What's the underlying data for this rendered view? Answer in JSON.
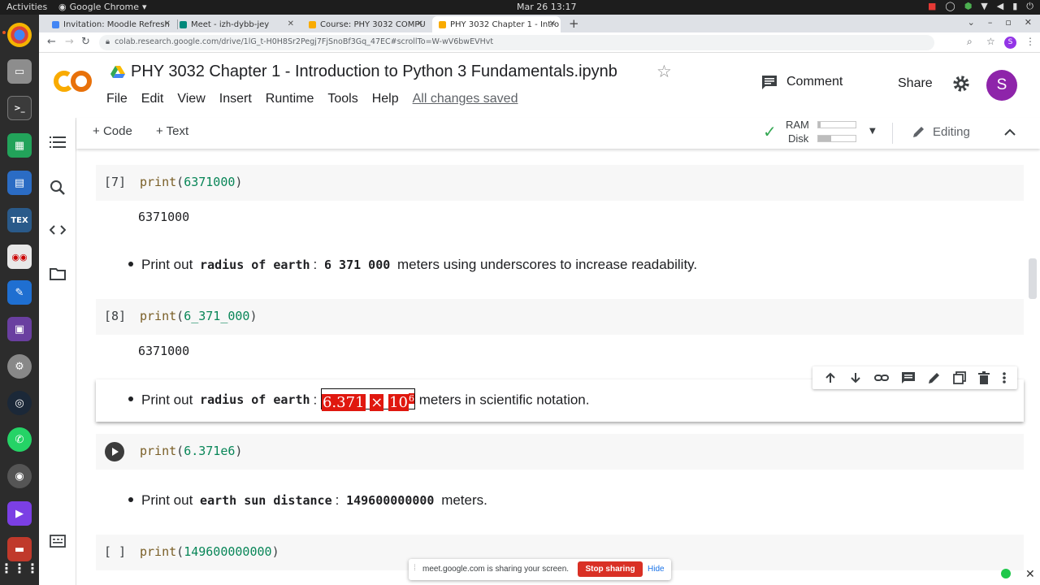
{
  "system_bar": {
    "activities": "Activities",
    "app_name": "Google Chrome",
    "clock": "Mar 26  13:17"
  },
  "browser": {
    "tabs": [
      {
        "label": "Invitation: Moodle Refresh",
        "favicon_color": "#4285f4"
      },
      {
        "label": "Meet - izh-dybb-jey",
        "favicon_color": "#00897b"
      },
      {
        "label": "Course: PHY 3032 COMPU",
        "favicon_color": "#f9ab00"
      },
      {
        "label": "PHY 3032 Chapter 1 - Intro",
        "favicon_color": "#f9ab00",
        "active": true
      }
    ],
    "url": "colab.research.google.com/drive/1lG_t-H0H8Sr2Pegj7FjSnoBf3Gq_47EC#scrollTo=W-wV6bwEVHvt",
    "avatar_letter": "S"
  },
  "colab": {
    "logo_text": "CO",
    "title": "PHY 3032 Chapter 1 - Introduction to Python 3 Fundamentals.ipynb",
    "menu": [
      "File",
      "Edit",
      "View",
      "Insert",
      "Runtime",
      "Tools",
      "Help"
    ],
    "save_status": "All changes saved",
    "comment_label": "Comment",
    "share_label": "Share",
    "account_letter": "S",
    "toolbar": {
      "add_code": "Code",
      "add_text": "Text",
      "ram_label": "RAM",
      "disk_label": "Disk",
      "ram_usage": 0.06,
      "disk_usage": 0.35,
      "editing_label": "Editing"
    }
  },
  "cells": {
    "c1": {
      "count": "[7]",
      "fn": "print",
      "arg": "6371000",
      "output": "6371000"
    },
    "t1": {
      "prefix": "Print out",
      "code": "radius of earth",
      "sep": ":",
      "value": "6 371 000",
      "suffix": "meters using underscores to increase readability."
    },
    "c2": {
      "count": "[8]",
      "fn": "print",
      "arg": "6_371_000",
      "output": "6371000"
    },
    "t2": {
      "prefix": "Print out",
      "code": "radius of earth",
      "sep": ":",
      "math_mantissa": "6.371",
      "math_times": "×",
      "math_base": "10",
      "math_exp": "6",
      "suffix": "meters in scientific notation."
    },
    "c3": {
      "fn": "print",
      "arg": "6.371e6"
    },
    "t3": {
      "prefix": "Print out",
      "code": "earth sun distance",
      "sep": ":",
      "value": "149600000000",
      "suffix": "meters."
    },
    "c4": {
      "count": "[ ]",
      "fn": "print",
      "arg": "149600000000"
    }
  },
  "sharing_bar": {
    "message": "meet.google.com is sharing your screen.",
    "stop_label": "Stop sharing",
    "hide_label": "Hide"
  }
}
